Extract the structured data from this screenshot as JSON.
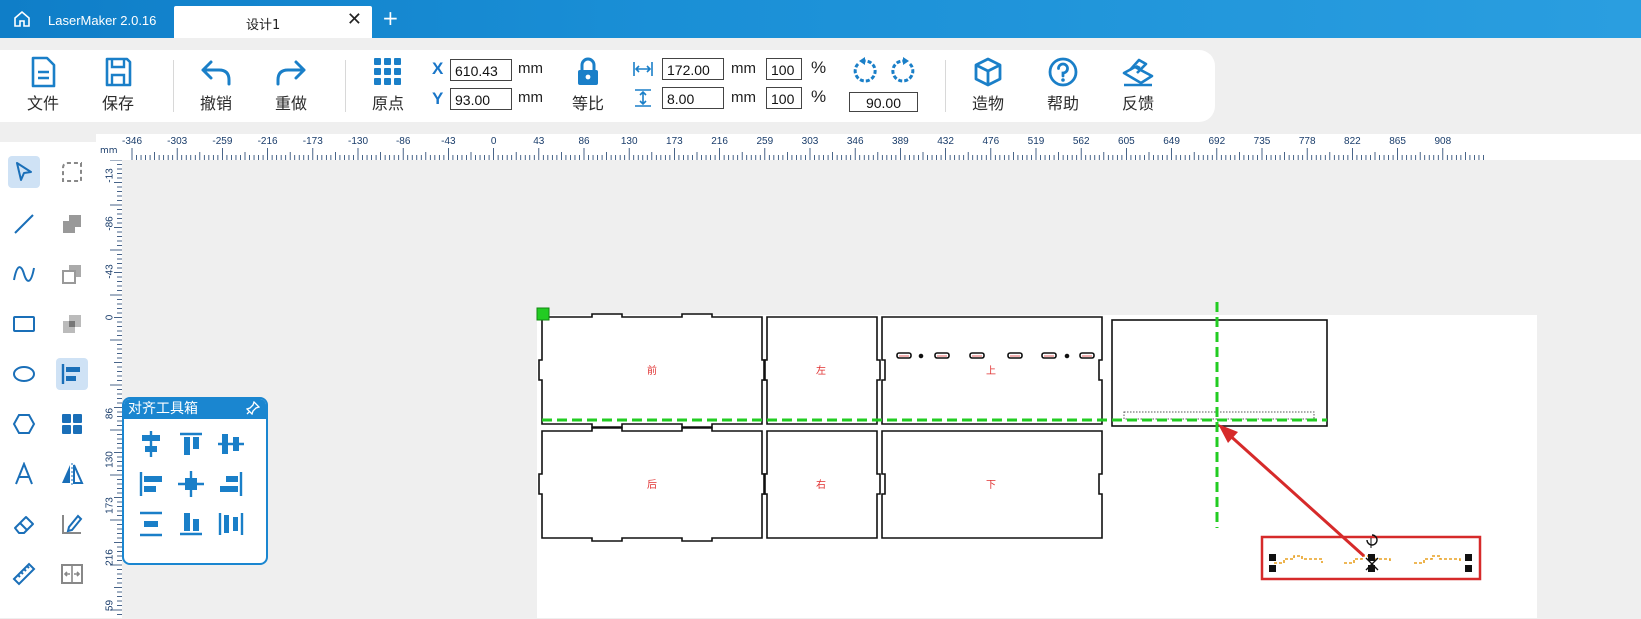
{
  "titlebar": {
    "app_name": "LaserMaker 2.0.16",
    "tab_title": "设计1",
    "close_glyph": "✕",
    "add_glyph": "+"
  },
  "toolbar": {
    "file": "文件",
    "save": "保存",
    "undo": "撤销",
    "redo": "重做",
    "origin": "原点",
    "x_label": "X",
    "y_label": "Y",
    "x_value": "610.43",
    "y_value": "93.00",
    "unit": "mm",
    "lock": "等比",
    "width_value": "172.00",
    "height_value": "8.00",
    "width_pct": "100",
    "height_pct": "100",
    "pct": "%",
    "rotation": "90.00",
    "build": "造物",
    "help": "帮助",
    "feedback": "反馈"
  },
  "ruler": {
    "unit": "mm",
    "top_ticks": [
      "-346",
      "-303",
      "-259",
      "-216",
      "-173",
      "-130",
      "-86",
      "-43",
      "0",
      "43",
      "86",
      "130",
      "173",
      "216",
      "259",
      "303",
      "346",
      "389",
      "432",
      "476",
      "519",
      "562",
      "605",
      "649",
      "692",
      "735",
      "778",
      "822",
      "865",
      "908"
    ],
    "left_ticks": [
      "-13",
      "-86",
      "-43",
      "0",
      "86",
      "130",
      "173",
      "216",
      "59"
    ]
  },
  "align_panel": {
    "title": "对齐工具箱"
  },
  "parts": {
    "front": "前",
    "left": "左",
    "top": "上",
    "back": "后",
    "right": "右",
    "bottom": "下"
  },
  "colors": {
    "accent": "#1a86d0",
    "guide": "#22cc22",
    "label_red": "#e03030",
    "highlight": "#d62a2a",
    "part_orange": "#e8a020"
  }
}
